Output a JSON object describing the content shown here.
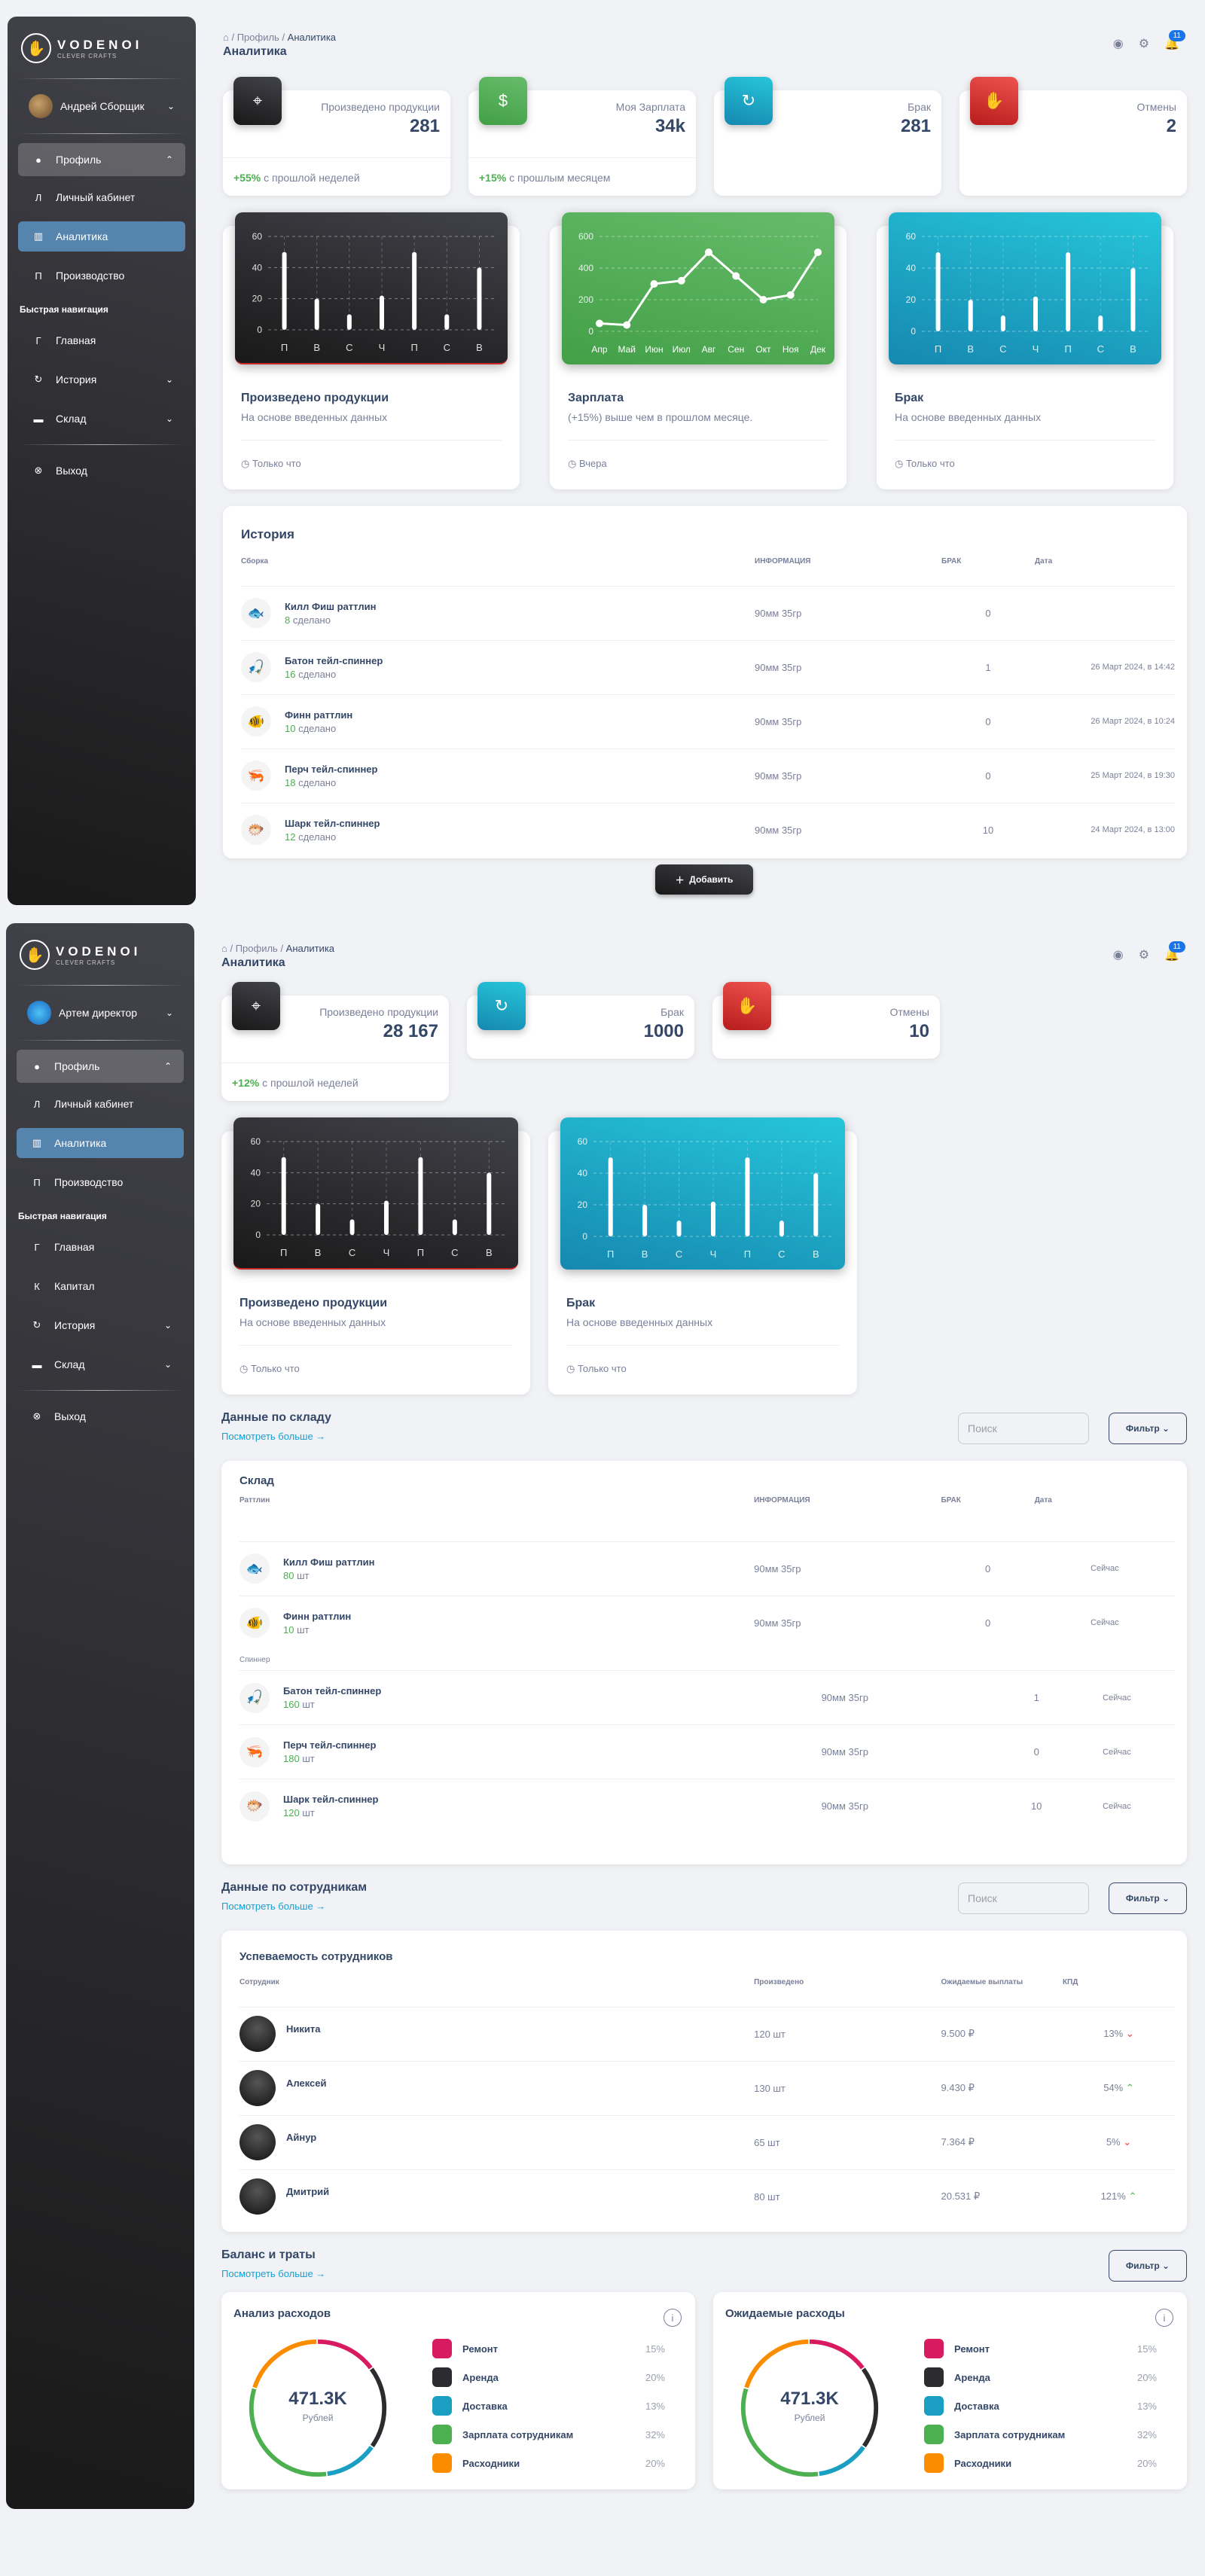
{
  "brand": {
    "name": "VODENOI",
    "subtitle": "CLEVER CRAFTS"
  },
  "nav": {
    "profile": "Профиль",
    "cabinet": "Личный кабинет",
    "analytics": "Аналитика",
    "production": "Производство",
    "quick_nav": "Быстрая навигация",
    "home": "Главная",
    "capital": "Капитал",
    "history": "История",
    "warehouse": "Склад",
    "logout": "Выход",
    "letters": {
      "cabinet": "Л",
      "production": "П",
      "home": "Г",
      "capital": "К"
    }
  },
  "breadcrumb": {
    "profile": "Профиль",
    "current": "Аналитика"
  },
  "page_title": "Аналитика",
  "notifications": "11",
  "s1": {
    "user": "Андрей Сборщик",
    "stats": [
      {
        "label": "Произведено продукции",
        "value": "281",
        "delta": "+55%",
        "delta_text": "с прошлой неделей"
      },
      {
        "label": "Моя Зарплата",
        "value": "34k",
        "delta": "+15%",
        "delta_text": "с прошлым месяцем"
      },
      {
        "label": "Брак",
        "value": "281"
      },
      {
        "label": "Отмены",
        "value": "2"
      }
    ],
    "charts": [
      {
        "title": "Произведено продукции",
        "desc": "На основе введенных данных",
        "foot": "Только что"
      },
      {
        "title": "Зарплата",
        "desc": "(+15%) выше чем в прошлом месяце.",
        "foot": "Вчера"
      },
      {
        "title": "Брак",
        "desc": "На основе введенных данных",
        "foot": "Только что"
      }
    ],
    "history": {
      "title": "История",
      "columns": [
        "Сборка",
        "ИНФОРМАЦИЯ",
        "БРАК",
        "Дата"
      ],
      "rows": [
        {
          "name": "Килл Фиш раттлин",
          "count": "8",
          "unit": "сделано",
          "info": "90мм 35гр",
          "defect": "0",
          "date": ""
        },
        {
          "name": "Батон тейл-спиннер",
          "count": "16",
          "unit": "сделано",
          "info": "90мм 35гр",
          "defect": "1",
          "date": "26 Март 2024, в 14:42"
        },
        {
          "name": "Финн раттлин",
          "count": "10",
          "unit": "сделано",
          "info": "90мм 35гр",
          "defect": "0",
          "date": "26 Март 2024, в 10:24"
        },
        {
          "name": "Перч тейл-спиннер",
          "count": "18",
          "unit": "сделано",
          "info": "90мм 35гр",
          "defect": "0",
          "date": "25 Март 2024, в 19:30"
        },
        {
          "name": "Шарк тейл-спиннер",
          "count": "12",
          "unit": "сделано",
          "info": "90мм 35гр",
          "defect": "10",
          "date": "24 Март 2024, в 13:00"
        }
      ]
    },
    "add_button": "Добавить"
  },
  "s2": {
    "user": "Артем директор",
    "stats": [
      {
        "label": "Произведено продукции",
        "value": "28 167",
        "delta": "+12%",
        "delta_text": "с прошлой неделей"
      },
      {
        "label": "Брак",
        "value": "1000"
      },
      {
        "label": "Отмены",
        "value": "10"
      }
    ],
    "charts": [
      {
        "title": "Произведено продукции",
        "desc": "На основе введенных данных",
        "foot": "Только что"
      },
      {
        "title": "Брак",
        "desc": "На основе введенных данных",
        "foot": "Только что"
      }
    ],
    "warehouse": {
      "section": "Данные по складу",
      "link": "Посмотреть больше →",
      "search": "Поиск",
      "filter": "Фильтр",
      "title": "Склад",
      "columns": [
        "Раттлин",
        "ИНФОРМАЦИЯ",
        "БРАК",
        "Дата"
      ],
      "group2": "Спиннер",
      "rows1": [
        {
          "name": "Килл Фиш раттлин",
          "count": "80",
          "unit": "шт",
          "info": "90мм 35гр",
          "defect": "0",
          "date": "Сейчас"
        },
        {
          "name": "Финн раттлин",
          "count": "10",
          "unit": "шт",
          "info": "90мм 35гр",
          "defect": "0",
          "date": "Сейчас"
        }
      ],
      "rows2": [
        {
          "name": "Батон тейл-спиннер",
          "count": "160",
          "unit": "шт",
          "info": "90мм 35гр",
          "defect": "1",
          "date": "Сейчас"
        },
        {
          "name": "Перч тейл-спиннер",
          "count": "180",
          "unit": "шт",
          "info": "90мм 35гр",
          "defect": "0",
          "date": "Сейчас"
        },
        {
          "name": "Шарк тейл-спиннер",
          "count": "120",
          "unit": "шт",
          "info": "90мм 35гр",
          "defect": "10",
          "date": "Сейчас"
        }
      ]
    },
    "employees": {
      "section": "Данные по сотрудникам",
      "link": "Посмотреть больше →",
      "search": "Поиск",
      "filter": "Фильтр",
      "title": "Успеваемость сотрудников",
      "columns": [
        "Сотрудник",
        "Произведено",
        "Ожидаемые выплаты",
        "КПД"
      ],
      "rows": [
        {
          "name": "Никита",
          "made": "120 шт",
          "pay": "9.500 ₽",
          "kpd": "13%",
          "trend": "down"
        },
        {
          "name": "Алексей",
          "made": "130 шт",
          "pay": "9.430 ₽",
          "kpd": "54%",
          "trend": "up"
        },
        {
          "name": "Айнур",
          "made": "65 шт",
          "pay": "7.364 ₽",
          "kpd": "5%",
          "trend": "down"
        },
        {
          "name": "Дмитрий",
          "made": "80 шт",
          "pay": "20.531 ₽",
          "kpd": "121%",
          "trend": "up"
        }
      ]
    },
    "balance": {
      "section": "Баланс и траты",
      "link": "Посмотреть больше →",
      "filter": "Фильтр",
      "cards": [
        {
          "title": "Анализ расходов",
          "total": "471.3K",
          "unit": "Рублей"
        },
        {
          "title": "Ожидаемые расходы",
          "total": "471.3K",
          "unit": "Рублей"
        }
      ],
      "legend": [
        {
          "name": "Ремонт",
          "pct": "15%",
          "color": "#d81b60"
        },
        {
          "name": "Аренда",
          "pct": "20%",
          "color": "#2b2b30"
        },
        {
          "name": "Доставка",
          "pct": "13%",
          "color": "#1a9fc2"
        },
        {
          "name": "Зарплата сотрудникам",
          "pct": "32%",
          "color": "#4caf50"
        },
        {
          "name": "Расходники",
          "pct": "20%",
          "color": "#fb8c00"
        }
      ]
    }
  },
  "chart_data": [
    {
      "type": "bar",
      "categories": [
        "П",
        "В",
        "С",
        "Ч",
        "П",
        "С",
        "В"
      ],
      "values": [
        50,
        20,
        10,
        22,
        50,
        10,
        40
      ],
      "ylim": [
        0,
        60
      ],
      "yticks": [
        0,
        20,
        40,
        60
      ]
    },
    {
      "type": "line",
      "categories": [
        "Апр",
        "Май",
        "Июн",
        "Июл",
        "Авг",
        "Сен",
        "Окт",
        "Ноя",
        "Дек"
      ],
      "values": [
        50,
        40,
        300,
        320,
        500,
        350,
        200,
        230,
        500
      ],
      "ylim": [
        0,
        600
      ],
      "yticks": [
        0,
        200,
        400,
        600
      ]
    },
    {
      "type": "bar",
      "categories": [
        "П",
        "В",
        "С",
        "Ч",
        "П",
        "С",
        "В"
      ],
      "values": [
        50,
        20,
        10,
        22,
        50,
        10,
        40
      ],
      "ylim": [
        0,
        60
      ],
      "yticks": [
        0,
        20,
        40,
        60
      ]
    }
  ],
  "colors": {
    "dark": "#2b2b30",
    "green": "#43a047",
    "cyan": "#1a9fc2",
    "red": "#c62828",
    "accent": "#5584ad"
  }
}
